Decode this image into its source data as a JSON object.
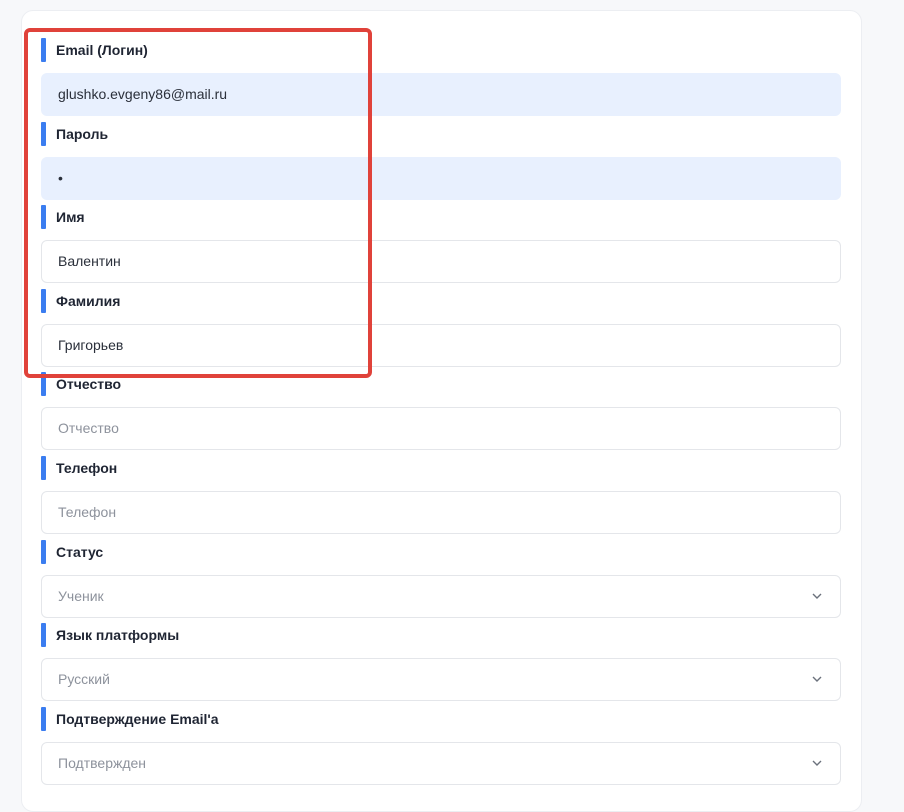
{
  "form": {
    "email": {
      "label": "Email (Логин)",
      "value": "glushko.evgeny86@mail.ru"
    },
    "password": {
      "label": "Пароль",
      "value": "•"
    },
    "first_name": {
      "label": "Имя",
      "value": "Валентин"
    },
    "last_name": {
      "label": "Фамилия",
      "value": "Григорьев"
    },
    "middle_name": {
      "label": "Отчество",
      "placeholder": "Отчество"
    },
    "phone": {
      "label": "Телефон",
      "placeholder": "Телефон"
    },
    "status": {
      "label": "Статус",
      "value": "Ученик",
      "icon": "chevron-down-icon"
    },
    "language": {
      "label": "Язык платформы",
      "value": "Русский",
      "icon": "chevron-down-icon"
    },
    "email_confirm": {
      "label": "Подтверждение Email'a",
      "value": "Подтвержден",
      "icon": "chevron-down-icon"
    }
  },
  "colors": {
    "accent": "#3b7df0",
    "highlight": "#e0423a",
    "autofill_bg": "#e8f0fe"
  }
}
